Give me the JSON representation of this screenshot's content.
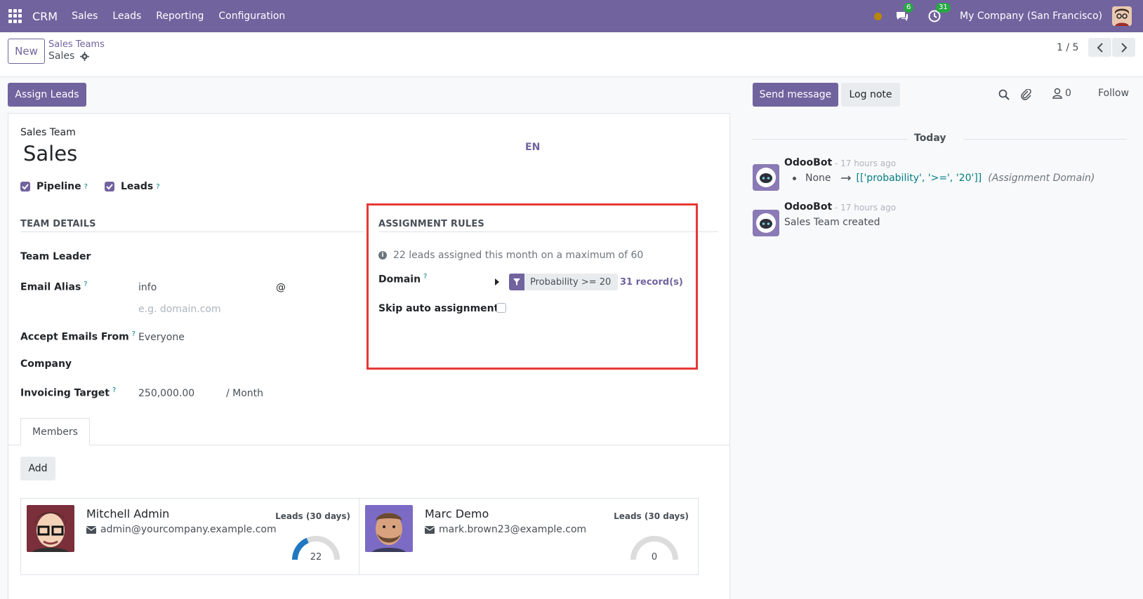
{
  "navbar": {
    "app_name": "CRM",
    "menu": [
      "Sales",
      "Leads",
      "Reporting",
      "Configuration"
    ],
    "messages_count": "6",
    "activities_count": "31",
    "company": "My Company (San Francisco)"
  },
  "control_panel": {
    "new_label": "New",
    "breadcrumb_parent": "Sales Teams",
    "breadcrumb_current": "Sales",
    "pager": "1 / 5"
  },
  "form": {
    "assign_leads_label": "Assign Leads",
    "sales_team_label": "Sales Team",
    "name": "Sales",
    "lang": "EN",
    "pipeline_label": "Pipeline",
    "leads_label": "Leads",
    "help_mark": "?",
    "team_details_title": "TEAM DETAILS",
    "team_leader_label": "Team Leader",
    "email_alias_label": "Email Alias",
    "email_alias_value": "info",
    "at_sign": "@",
    "domain_placeholder": "e.g. domain.com",
    "accept_emails_label": "Accept Emails From",
    "accept_emails_value": "Everyone",
    "company_label": "Company",
    "invoicing_target_label": "Invoicing Target",
    "invoicing_target_value": "250,000.00",
    "invoicing_period": "/ Month",
    "assignment_rules_title": "ASSIGNMENT RULES",
    "assignment_info": "22 leads assigned this month on a maximum of 60",
    "domain_label": "Domain",
    "domain_filter": "Probability >= 20",
    "records_link": "31 record(s)",
    "skip_auto_label": "Skip auto assignment",
    "members_tab": "Members",
    "add_label": "Add",
    "members": [
      {
        "name": "Mitchell Admin",
        "email": "admin@yourcompany.example.com",
        "leads_label": "Leads (30 days)",
        "leads": "22",
        "leads_ratio": 0.37
      },
      {
        "name": "Marc Demo",
        "email": "mark.brown23@example.com",
        "leads_label": "Leads (30 days)",
        "leads": "0",
        "leads_ratio": 0
      }
    ]
  },
  "chatter": {
    "send_message_label": "Send message",
    "log_note_label": "Log note",
    "followers_count": "0",
    "follow_label": "Follow",
    "today_label": "Today",
    "messages": [
      {
        "author": "OdooBot",
        "time": "- 17 hours ago",
        "old_value": "None",
        "new_value": "[['probability', '>=', '20']]",
        "field": "(Assignment Domain)"
      },
      {
        "author": "OdooBot",
        "time": "- 17 hours ago",
        "body": "Sales Team created"
      }
    ]
  },
  "colors": {
    "brand": "#71639e",
    "highlight_box": "#e53935",
    "gauge": "#1f78c1",
    "badge": "#28a745"
  }
}
